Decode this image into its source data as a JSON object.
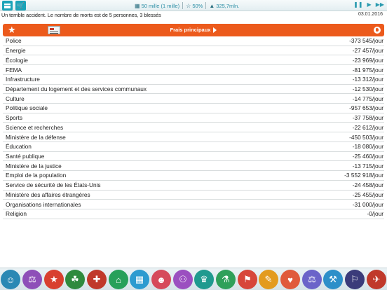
{
  "topbar": {
    "stats": [
      {
        "icon": "people-icon",
        "value": "50 mille (1 mille)"
      },
      {
        "icon": "rating-icon",
        "value": "50%"
      },
      {
        "icon": "budget-icon",
        "value": "325,7mln."
      }
    ]
  },
  "news": {
    "text": "Un terrible accident. Le nombre de morts est de 5 personnes, 3  blessés",
    "date": "03.01.2016"
  },
  "header": {
    "title": "Frais principaux"
  },
  "expenses": [
    {
      "name": "Police",
      "value": "-373 545/jour"
    },
    {
      "name": "Énergie",
      "value": "-27 457/jour"
    },
    {
      "name": "Écologie",
      "value": "-23 969/jour"
    },
    {
      "name": "FEMA",
      "value": "-81 975/jour"
    },
    {
      "name": "Infrastructure",
      "value": "-13 312/jour"
    },
    {
      "name": "Département du logement et des services communaux",
      "value": "-12 530/jour"
    },
    {
      "name": "Culture",
      "value": "-14 775/jour"
    },
    {
      "name": "Politique sociale",
      "value": "-957 653/jour"
    },
    {
      "name": "Sports",
      "value": "-37 758/jour"
    },
    {
      "name": "Science et recherches",
      "value": "-22 612/jour"
    },
    {
      "name": "Ministère de la défense",
      "value": "-450 503/jour"
    },
    {
      "name": "Éducation",
      "value": "-18 080/jour"
    },
    {
      "name": "Santé publique",
      "value": "-25 460/jour"
    },
    {
      "name": "Ministère de la justice",
      "value": "-13 715/jour"
    },
    {
      "name": "Emploi de la population",
      "value": "-3 552 918/jour"
    },
    {
      "name": "Service de sécurité de les États-Unis",
      "value": "-24 458/jour"
    },
    {
      "name": "Ministère des affaires étrangères",
      "value": "-25 455/jour"
    },
    {
      "name": "Organisations internationales",
      "value": "-31 000/jour"
    },
    {
      "name": "Religion",
      "value": "-0/jour"
    }
  ],
  "dock": [
    {
      "icon": "ministers-icon",
      "color": "#2a88b4"
    },
    {
      "icon": "finance-icon",
      "color": "#8e4fb8"
    },
    {
      "icon": "police-icon",
      "color": "#d8402f"
    },
    {
      "icon": "ecology-icon",
      "color": "#2f8a3e"
    },
    {
      "icon": "emergency-icon",
      "color": "#c0392b"
    },
    {
      "icon": "industry-icon",
      "color": "#27a05a"
    },
    {
      "icon": "housing-icon",
      "color": "#2d9bd0"
    },
    {
      "icon": "culture-icon",
      "color": "#d64a5b"
    },
    {
      "icon": "social-icon",
      "color": "#9b4fc0"
    },
    {
      "icon": "sports-icon",
      "color": "#1f9a8f"
    },
    {
      "icon": "science-icon",
      "color": "#2fa05a"
    },
    {
      "icon": "defense-icon",
      "color": "#d7463a"
    },
    {
      "icon": "education-icon",
      "color": "#e39b1f"
    },
    {
      "icon": "health-icon",
      "color": "#e05a3c"
    },
    {
      "icon": "justice-icon",
      "color": "#6b63c9"
    },
    {
      "icon": "employment-icon",
      "color": "#2d8fc9"
    },
    {
      "icon": "security-icon",
      "color": "#3b3b7a"
    },
    {
      "icon": "foreign-icon",
      "color": "#c0392b"
    }
  ]
}
